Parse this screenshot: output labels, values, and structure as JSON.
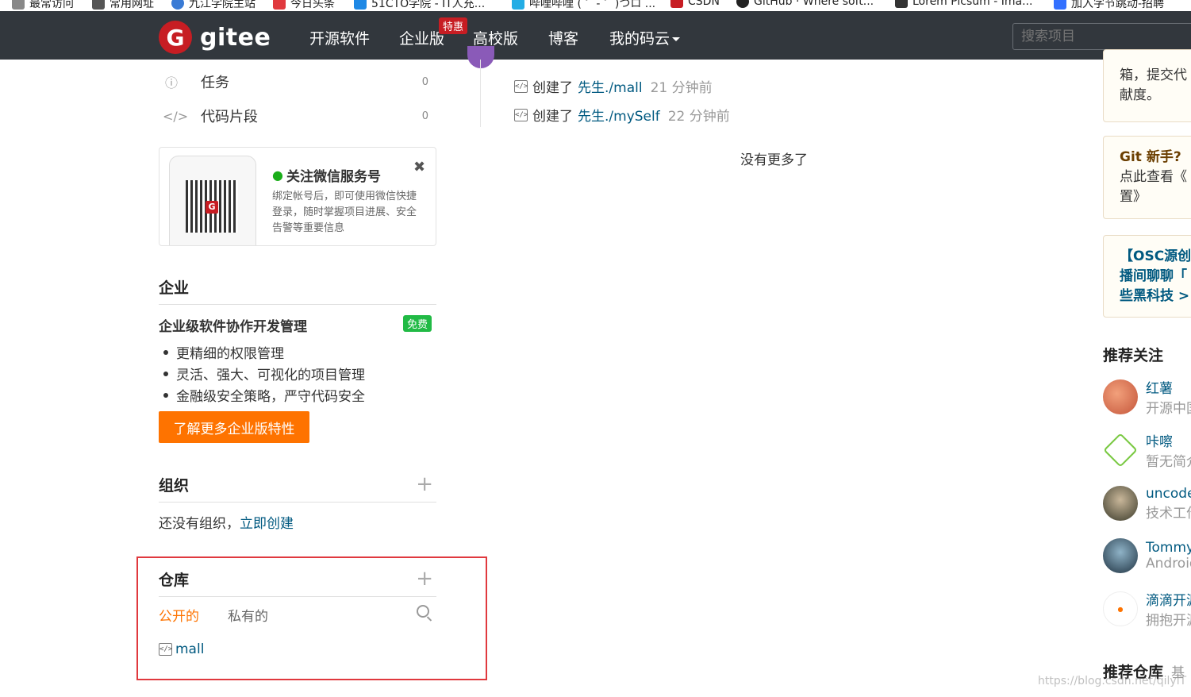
{
  "bookmarks": [
    {
      "label": "最常访问",
      "color": "#888888"
    },
    {
      "label": "常用网址",
      "color": "#555555"
    },
    {
      "label": "九江学院主站",
      "color": "#3a7bd5"
    },
    {
      "label": "今日头条",
      "color": "#e0393e"
    },
    {
      "label": "51CTO学院 - IT人充...",
      "color": "#1e88e5"
    },
    {
      "label": "哔哩哔哩 ( ゜- ゜)つロ ...",
      "color": "#23ade5"
    },
    {
      "label": "CSDN",
      "color": "#c71d23"
    },
    {
      "label": "GitHub · Where soft...",
      "color": "#222222"
    },
    {
      "label": "Lorem Picsum - Ima...",
      "color": "#333333"
    },
    {
      "label": "加入字节跳动-招聘",
      "color": "#3370ff"
    }
  ],
  "nav": {
    "logo_letter": "G",
    "logo_text": "gitee",
    "links": [
      "开源软件",
      "企业版",
      "高校版",
      "博客",
      "我的码云"
    ],
    "special_badge": "特惠",
    "search_placeholder": "搜索项目"
  },
  "sidebar": {
    "items": [
      {
        "label": "任务",
        "count": "0",
        "icon": "issue-icon"
      },
      {
        "label": "代码片段",
        "count": "0",
        "icon": "code-snippet-icon"
      }
    ]
  },
  "wechat": {
    "title": "关注微信服务号",
    "desc": "绑定帐号后，即可使用微信快捷登录，随时掌握项目进展、安全告警等重要信息",
    "qr_letter": "G",
    "close": "✖"
  },
  "enterprise": {
    "title": "企业",
    "subtitle": "企业级软件协作开发管理",
    "badge": "免费",
    "features": [
      "更精细的权限管理",
      "灵活、强大、可视化的项目管理",
      "金融级安全策略，严守代码安全"
    ],
    "cta": "了解更多企业版特性"
  },
  "orgs": {
    "title": "组织",
    "empty_text": "还没有组织，",
    "create_link": "立即创建"
  },
  "repos": {
    "title": "仓库",
    "tabs": [
      "公开的",
      "私有的"
    ],
    "items": [
      "mall"
    ]
  },
  "feed": {
    "rows": [
      {
        "action": "创建了",
        "repo": "先生./mall",
        "time": "21 分钟前"
      },
      {
        "action": "创建了",
        "repo": "先生./mySelf",
        "time": "22 分钟前"
      }
    ],
    "no_more": "没有更多了"
  },
  "right": {
    "card1": [
      "箱，提交代",
      "献度。"
    ],
    "card2_title": "Git 新手?",
    "card2_text": [
      "点此查看《",
      "置》"
    ],
    "card3": [
      "【OSC源创",
      "播间聊聊「",
      "些黑科技 > "
    ],
    "recommend_title": "推荐关注",
    "recommend": [
      {
        "name": "红薯",
        "desc": "开源中国",
        "color": "#e2775a"
      },
      {
        "name": "咔嚓",
        "desc": "暂无简介",
        "color": "#ffffff"
      },
      {
        "name": "uncode",
        "desc": "技术工作",
        "color": "#4a4a3a"
      },
      {
        "name": "Tommy",
        "desc": "Android",
        "color": "#3b5a6e"
      },
      {
        "name": "滴滴开源",
        "desc": "拥抱开源",
        "color": "#ffffff"
      }
    ],
    "repo_title": "推荐仓库",
    "repo_sub": "基"
  },
  "watermark": "https://blog.csdn.net/qilyiT"
}
